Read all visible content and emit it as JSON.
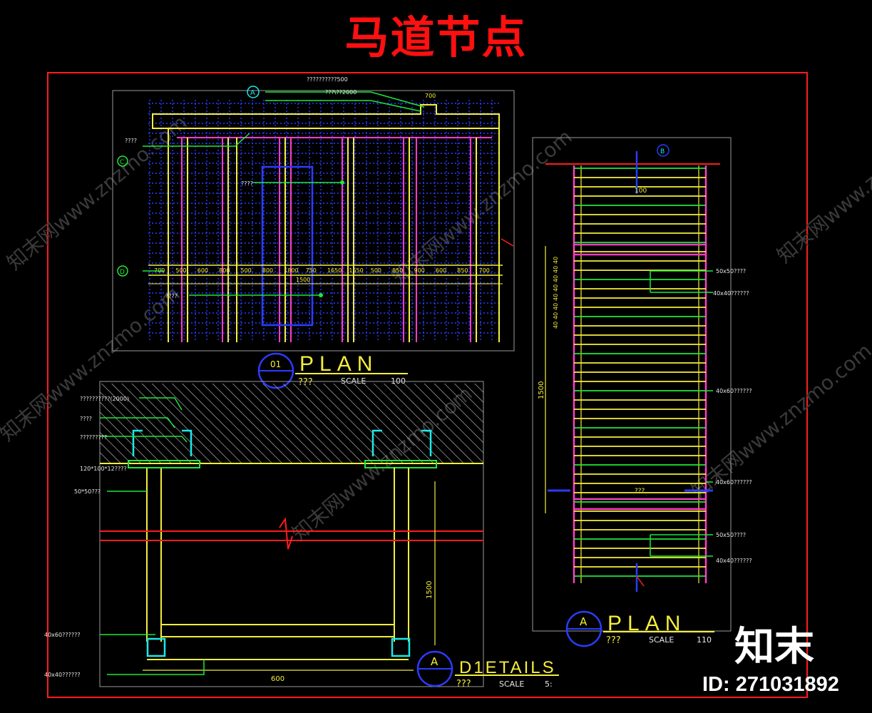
{
  "title": "马道节点",
  "views": {
    "plan_top": {
      "bubble_label": "01",
      "title_word": "PLAN",
      "subtitle": "???",
      "scale_label": "SCALE",
      "scale_value": "100",
      "callouts": [
        "??????????500",
        "???\\??2000",
        "????",
        "????",
        "????"
      ],
      "axis_tags": [
        "A",
        "B",
        "C",
        "D"
      ],
      "dims": [
        "700",
        "500",
        "600",
        "800",
        "500",
        "800",
        "1800",
        "750",
        "1650",
        "1650",
        "500",
        "850",
        "900",
        "600",
        "850",
        "700"
      ],
      "total_dim": "1500",
      "top_dim": "700"
    },
    "plan_right": {
      "bubble_label": "A",
      "title_word": "PLAN",
      "subtitle": "???",
      "scale_label": "SCALE",
      "scale_value": "110",
      "top_dim": "100",
      "side_dim": "1500",
      "mid_label": "???",
      "spacing_marks": [
        "40",
        "40",
        "40",
        "40",
        "40",
        "40",
        "40",
        "40"
      ],
      "callouts": [
        "50x50????",
        "40x40??????",
        "40x60??????",
        "40x60??????",
        "50x50????",
        "40x40??????"
      ]
    },
    "detail": {
      "bubble_label": "A",
      "title_word": "D1ETAILS",
      "subtitle": "???",
      "scale_label": "SCALE",
      "scale_value": "5:",
      "callouts": [
        "??????????(2000)",
        "????",
        "?????????",
        "120*100*12????",
        "50*50???",
        "40x60??????",
        "40x40??????"
      ],
      "height_dim": "1500",
      "width_dim": "600"
    }
  },
  "watermark": {
    "brand": "知末",
    "id": "ID: 271031892",
    "diagonal_text": "知末网www.znzmo.com"
  },
  "colors": {
    "background": "#000000",
    "frame": "#ff1c1c",
    "yellow": "#f4ee3a",
    "magenta": "#ff3cc8",
    "blue": "#2a3cff",
    "green": "#1ee838",
    "cyan": "#1ee8e8",
    "white": "#e8e8e8"
  }
}
